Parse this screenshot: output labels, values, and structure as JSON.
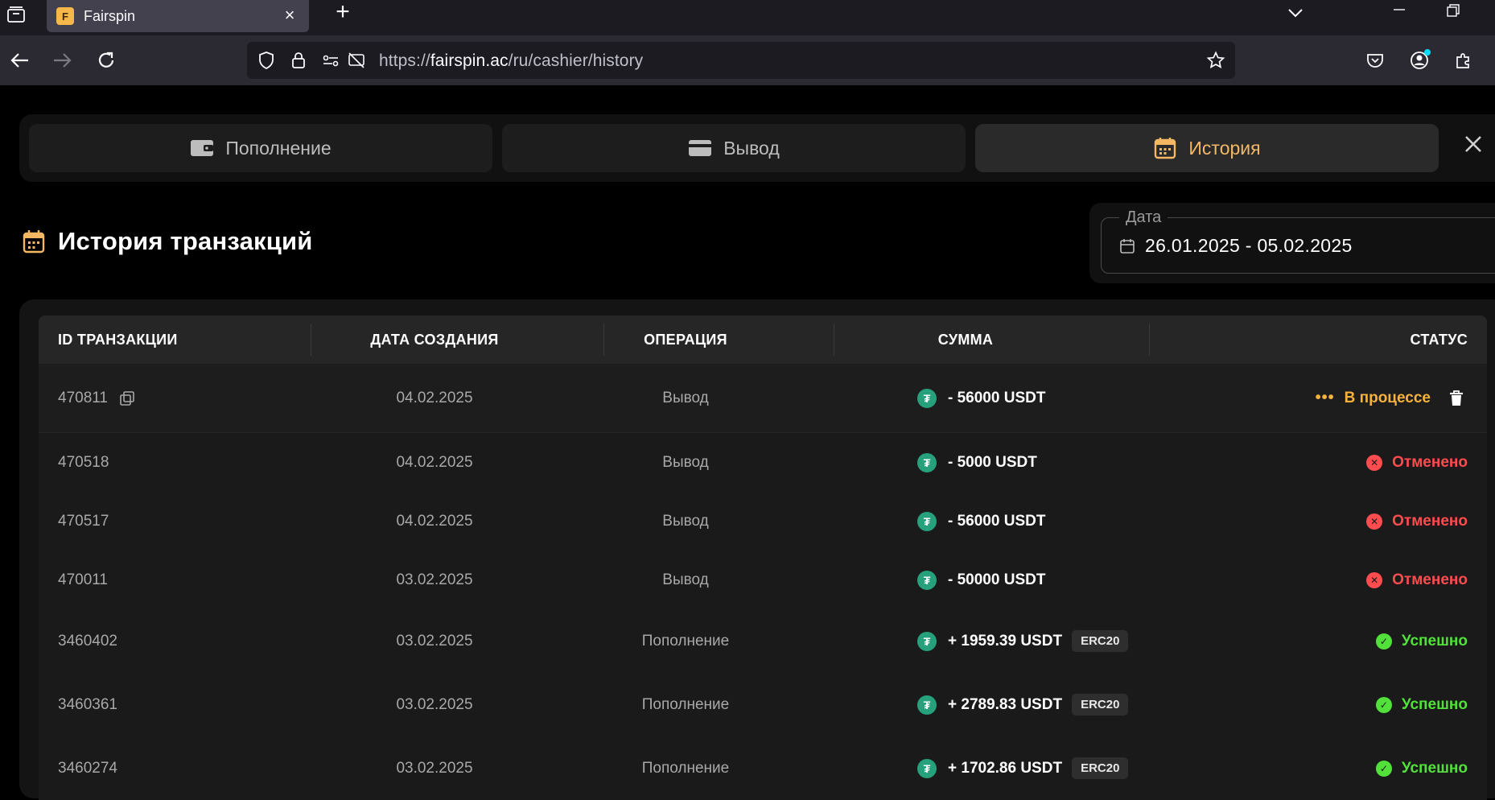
{
  "browser": {
    "tab_title": "Fairspin",
    "url_prefix": "https://",
    "url_host": "fairspin.ac",
    "url_path": "/ru/cashier/history"
  },
  "cashier_tabs": [
    {
      "label": "Пополнение",
      "icon": "wallet-icon",
      "active": false
    },
    {
      "label": "Вывод",
      "icon": "card-icon",
      "active": false
    },
    {
      "label": "История",
      "icon": "calendar-icon",
      "active": true
    }
  ],
  "history": {
    "title": "История транзакций",
    "date_label": "Дата",
    "date_range": "26.01.2025 - 05.02.2025"
  },
  "table": {
    "headers": {
      "id": "ID ТРАНЗАКЦИИ",
      "date": "ДАТА СОЗДАНИЯ",
      "operation": "ОПЕРАЦИЯ",
      "amount": "СУММА",
      "status": "СТАТУС"
    },
    "rows": [
      {
        "id": "470811",
        "date": "04.02.2025",
        "operation": "Вывод",
        "amount": "- 56000 USDT",
        "network": "",
        "status": "В процессе",
        "status_type": "pending"
      },
      {
        "id": "470518",
        "date": "04.02.2025",
        "operation": "Вывод",
        "amount": "- 5000 USDT",
        "network": "",
        "status": "Отменено",
        "status_type": "cancel"
      },
      {
        "id": "470517",
        "date": "04.02.2025",
        "operation": "Вывод",
        "amount": "- 56000 USDT",
        "network": "",
        "status": "Отменено",
        "status_type": "cancel"
      },
      {
        "id": "470011",
        "date": "03.02.2025",
        "operation": "Вывод",
        "amount": "- 50000 USDT",
        "network": "",
        "status": "Отменено",
        "status_type": "cancel"
      },
      {
        "id": "3460402",
        "date": "03.02.2025",
        "operation": "Пополнение",
        "amount": "+ 1959.39 USDT",
        "network": "ERC20",
        "status": "Успешно",
        "status_type": "success"
      },
      {
        "id": "3460361",
        "date": "03.02.2025",
        "operation": "Пополнение",
        "amount": "+ 2789.83 USDT",
        "network": "ERC20",
        "status": "Успешно",
        "status_type": "success"
      },
      {
        "id": "3460274",
        "date": "03.02.2025",
        "operation": "Пополнение",
        "amount": "+ 1702.86 USDT",
        "network": "ERC20",
        "status": "Успешно",
        "status_type": "success"
      }
    ]
  },
  "colors": {
    "accent": "#f4b864",
    "pending": "#f6b23b",
    "cancel": "#ff4d4f",
    "success": "#52e03b",
    "usdt": "#26a17b"
  }
}
